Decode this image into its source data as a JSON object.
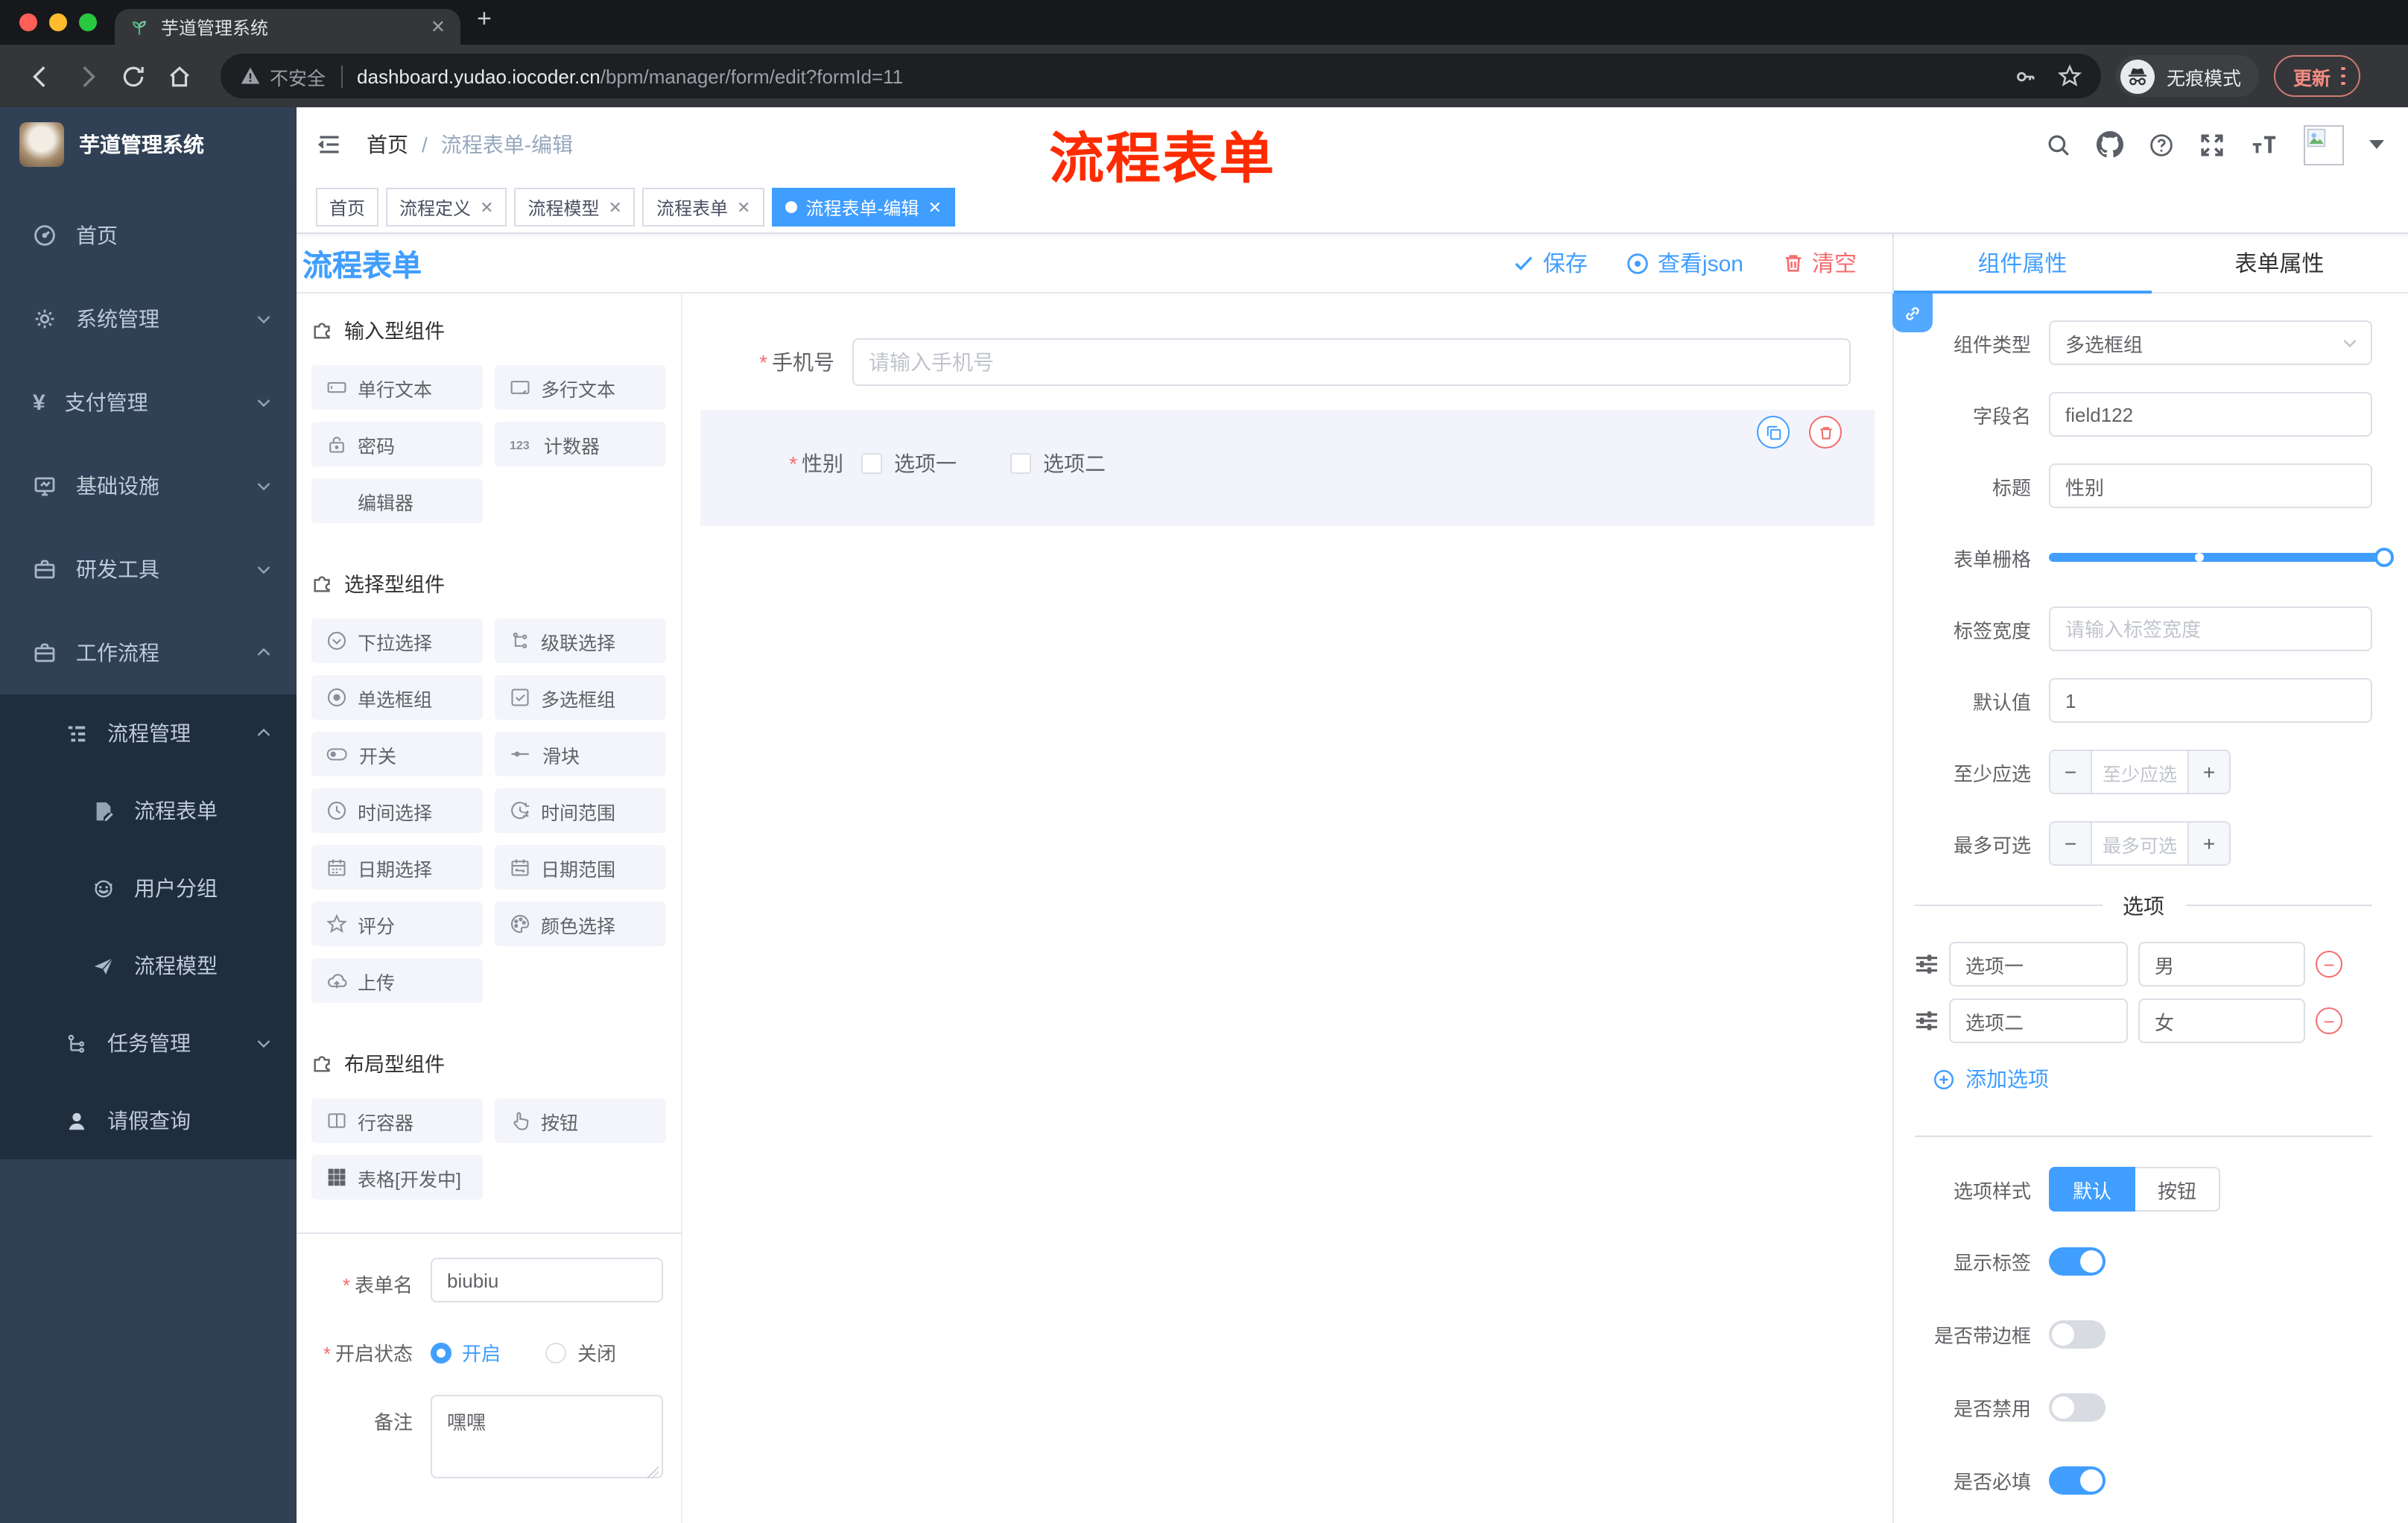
{
  "browser": {
    "tab_title": "芋道管理系统",
    "security_label": "不安全",
    "url_host": "dashboard.yudao.iocoder.cn",
    "url_path": "/bpm/manager/form/edit?formId=11",
    "incognito_label": "无痕模式",
    "update_label": "更新"
  },
  "sidebar": {
    "app_title": "芋道管理系统",
    "items": [
      {
        "label": "首页",
        "icon": "dashboard-icon"
      },
      {
        "label": "系统管理",
        "icon": "gear-icon"
      },
      {
        "label": "支付管理",
        "icon": "yen-icon"
      },
      {
        "label": "基础设施",
        "icon": "monitor-icon"
      },
      {
        "label": "研发工具",
        "icon": "briefcase-icon"
      },
      {
        "label": "工作流程",
        "icon": "briefcase-icon"
      }
    ],
    "workflow_children": [
      {
        "label": "流程管理",
        "icon": "tree-table-icon"
      },
      {
        "label": "流程表单",
        "icon": "form-edit-icon"
      },
      {
        "label": "用户分组",
        "icon": "robot-icon"
      },
      {
        "label": "流程模型",
        "icon": "paper-plane-icon"
      },
      {
        "label": "任务管理",
        "icon": "tree-icon"
      },
      {
        "label": "请假查询",
        "icon": "user-icon"
      }
    ]
  },
  "header": {
    "breadcrumb": [
      "首页",
      "流程表单-编辑"
    ],
    "annotation": "流程表单"
  },
  "tags": [
    {
      "label": "首页"
    },
    {
      "label": "流程定义"
    },
    {
      "label": "流程模型"
    },
    {
      "label": "流程表单"
    },
    {
      "label": "流程表单-编辑"
    }
  ],
  "designer": {
    "title": "流程表单",
    "save_label": "保存",
    "view_json_label": "查看json",
    "clear_label": "清空",
    "palette": {
      "input_section": "输入型组件",
      "input_items": [
        "单行文本",
        "多行文本",
        "密码",
        "计数器",
        "编辑器"
      ],
      "select_section": "选择型组件",
      "select_items": [
        "下拉选择",
        "级联选择",
        "单选框组",
        "多选框组",
        "开关",
        "滑块",
        "时间选择",
        "时间范围",
        "日期选择",
        "日期范围",
        "评分",
        "颜色选择",
        "上传"
      ],
      "layout_section": "布局型组件",
      "layout_items": [
        "行容器",
        "按钮",
        "表格[开发中]"
      ]
    },
    "meta": {
      "name_label": "表单名",
      "name_value": "biubiu",
      "status_label": "开启状态",
      "status_on": "开启",
      "status_off": "关闭",
      "remark_label": "备注",
      "remark_value": "嘿嘿"
    },
    "canvas": {
      "phone_label": "手机号",
      "phone_placeholder": "请输入手机号",
      "gender_label": "性别",
      "gender_options": [
        "选项一",
        "选项二"
      ]
    }
  },
  "props": {
    "tab_component": "组件属性",
    "tab_form": "表单属性",
    "type_label": "组件类型",
    "type_value": "多选框组",
    "field_label": "字段名",
    "field_value": "field122",
    "title_label": "标题",
    "title_value": "性别",
    "grid_label": "表单栅格",
    "labelwidth_label": "标签宽度",
    "labelwidth_placeholder": "请输入标签宽度",
    "default_label": "默认值",
    "default_value": "1",
    "min_label": "至少应选",
    "min_placeholder": "至少应选",
    "max_label": "最多可选",
    "max_placeholder": "最多可选",
    "options_title": "选项",
    "options": [
      {
        "label": "选项一",
        "value": "男"
      },
      {
        "label": "选项二",
        "value": "女"
      }
    ],
    "add_option": "添加选项",
    "style_label": "选项样式",
    "style_default": "默认",
    "style_button": "按钮",
    "toggles": [
      {
        "label": "显示标签",
        "on": true
      },
      {
        "label": "是否带边框",
        "on": false
      },
      {
        "label": "是否禁用",
        "on": false
      },
      {
        "label": "是否必填",
        "on": true
      }
    ]
  },
  "colors": {
    "accent": "#409eff",
    "danger": "#f56c6c",
    "annotation_red": "#fe2b00",
    "sidebar_bg": "#304156",
    "submenu_bg": "#1f2d3d"
  }
}
